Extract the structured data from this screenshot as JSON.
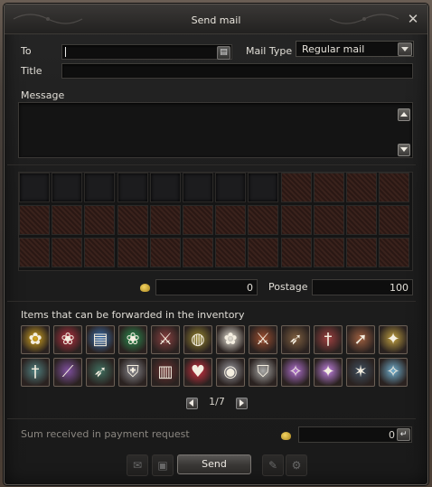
{
  "window": {
    "title": "Send mail",
    "close_icon": "close-icon"
  },
  "form": {
    "to_label": "To",
    "to_value": "",
    "title_label": "Title",
    "title_value": "",
    "mail_type_label": "Mail Type",
    "mail_type_value": "Regular mail",
    "message_label": "Message",
    "message_value": ""
  },
  "attachments": {
    "rows": 3,
    "cols": 12,
    "open_slots": 8,
    "money_value": "0",
    "postage_label": "Postage",
    "postage_value": "100"
  },
  "inventory": {
    "label": "Items that can be forwarded in the inventory",
    "items": [
      {
        "icon": "gold-flower-icon",
        "color": "#d8a820",
        "glyph": "✿"
      },
      {
        "icon": "red-rose-icon",
        "color": "#b83040",
        "glyph": "❀"
      },
      {
        "icon": "blue-scroll-icon",
        "color": "#3a70b0",
        "glyph": "▤"
      },
      {
        "icon": "green-rose-icon",
        "color": "#2a9050",
        "glyph": "❀"
      },
      {
        "icon": "sword-icon",
        "color": "#8a4040",
        "glyph": "⚔"
      },
      {
        "icon": "bag-icon",
        "color": "#9a8a30",
        "glyph": "◍"
      },
      {
        "icon": "white-flower-icon",
        "color": "#e8e4d8",
        "glyph": "✿"
      },
      {
        "icon": "blade-icon",
        "color": "#a05030",
        "glyph": "⚔"
      },
      {
        "icon": "crossbow-icon",
        "color": "#806040",
        "glyph": "➶"
      },
      {
        "icon": "dagger-icon",
        "color": "#a04040",
        "glyph": "†"
      },
      {
        "icon": "spear-icon",
        "color": "#a06040",
        "glyph": "➚"
      },
      {
        "icon": "golden-staff-icon",
        "color": "#c0a040",
        "glyph": "✦"
      },
      {
        "icon": "knife-icon",
        "color": "#508080",
        "glyph": "†"
      },
      {
        "icon": "wand-icon",
        "color": "#8050a0",
        "glyph": "⟋"
      },
      {
        "icon": "bow-icon",
        "color": "#407060",
        "glyph": "➶"
      },
      {
        "icon": "armor-icon",
        "color": "#8a8a90",
        "glyph": "⛨"
      },
      {
        "icon": "book-icon",
        "color": "#6a3030",
        "glyph": "▥"
      },
      {
        "icon": "heart-amulet-icon",
        "color": "#d03040",
        "glyph": "♥"
      },
      {
        "icon": "gray-orb-icon",
        "color": "#9a9aa0",
        "glyph": "◉"
      },
      {
        "icon": "gauntlet-icon",
        "color": "#aaaaa8",
        "glyph": "⛉"
      },
      {
        "icon": "purple-gem-scroll-icon",
        "color": "#b070d0",
        "glyph": "✧"
      },
      {
        "icon": "purple-crystal-scroll-icon",
        "color": "#c080e0",
        "glyph": "✦"
      },
      {
        "icon": "dark-star-scroll-icon",
        "color": "#405060",
        "glyph": "✶"
      },
      {
        "icon": "light-blue-scroll-icon",
        "color": "#70b0d0",
        "glyph": "✧"
      }
    ],
    "page": "1/7"
  },
  "payment": {
    "label": "Sum received in payment request",
    "value": "0"
  },
  "actions": {
    "send_label": "Send"
  }
}
